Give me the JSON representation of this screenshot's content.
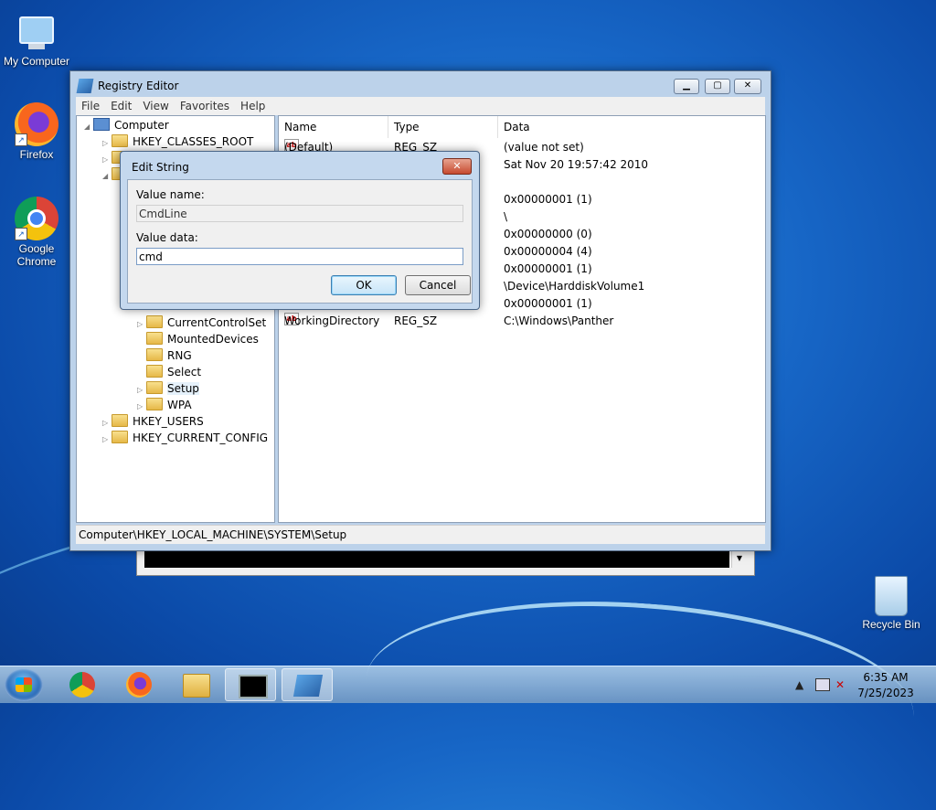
{
  "desktop": {
    "icons": [
      {
        "label": "My Computer",
        "icon": "computer-icon"
      },
      {
        "label": "Firefox",
        "icon": "firefox-icon"
      },
      {
        "label": "Google\nChrome",
        "icon": "chrome-icon"
      },
      {
        "label": "Recycle Bin",
        "icon": "recycle-bin-icon"
      }
    ]
  },
  "regedit": {
    "title": "Registry Editor",
    "menu": [
      "File",
      "Edit",
      "View",
      "Favorites",
      "Help"
    ],
    "tree": [
      {
        "label": "Computer",
        "level": 0,
        "icon": "computer-icon"
      },
      {
        "label": "HKEY_CLASSES_ROOT",
        "level": 1
      },
      {
        "label": "CurrentControlSet",
        "level": 2
      },
      {
        "label": "MountedDevices",
        "level": 2
      },
      {
        "label": "RNG",
        "level": 2
      },
      {
        "label": "Select",
        "level": 2
      },
      {
        "label": "Setup",
        "level": 2,
        "selected": true
      },
      {
        "label": "WPA",
        "level": 2
      },
      {
        "label": "HKEY_USERS",
        "level": 1
      },
      {
        "label": "HKEY_CURRENT_CONFIG",
        "level": 1
      }
    ],
    "columns": [
      "Name",
      "Type",
      "Data"
    ],
    "values": [
      {
        "name": "(Default)",
        "type": "REG_SZ",
        "data": "(value not set)"
      },
      {
        "name": "",
        "type": "",
        "data": "Sat Nov 20 19:57:42 2010"
      },
      {
        "name": "",
        "type": "",
        "data": "0x00000001 (1)"
      },
      {
        "name": "",
        "type": "",
        "data": "\\"
      },
      {
        "name": "",
        "type": "",
        "data": "0x00000000 (0)"
      },
      {
        "name": "",
        "type": "",
        "data": "0x00000004 (4)"
      },
      {
        "name": "",
        "type": "",
        "data": "0x00000001 (1)"
      },
      {
        "name": "",
        "type": "",
        "data": "\\Device\\HarddiskVolume1"
      },
      {
        "name": "",
        "type": "",
        "data": "0x00000001 (1)"
      },
      {
        "name": "WorkingDirectory",
        "type": "REG_SZ",
        "data": "C:\\Windows\\Panther"
      }
    ],
    "status": "Computer\\HKEY_LOCAL_MACHINE\\SYSTEM\\Setup",
    "buttons": {
      "minimize": "▁",
      "maximize": "▢",
      "close": "✕"
    }
  },
  "dialog": {
    "title": "Edit String",
    "value_name_label": "Value name:",
    "value_name": "CmdLine",
    "value_data_label": "Value data:",
    "value_data": "cmd",
    "ok": "OK",
    "cancel": "Cancel",
    "close": "✕"
  },
  "cmd_window": {
    "scroll_arrow": "▼"
  },
  "taskbar": {
    "apps": [
      "chrome-icon",
      "firefox-icon",
      "explorer-icon",
      "cmd-icon",
      "regedit-icon"
    ],
    "time": "6:35 AM",
    "date": "7/25/2023",
    "tray_chevron": "▲"
  }
}
